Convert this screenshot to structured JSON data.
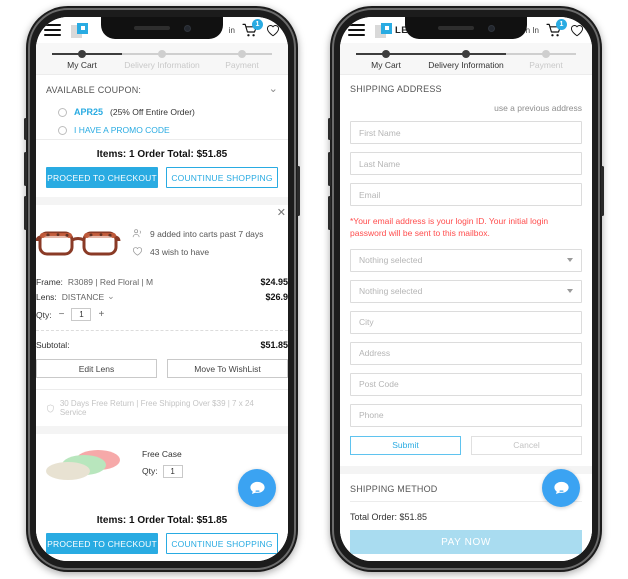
{
  "cart_phone": {
    "header": {
      "menu_icon": "hamburger-menu-icon",
      "brand_name": "",
      "sign_in_label": "in",
      "cart_icon": "shopping-cart-icon",
      "cart_badge": "1",
      "wishlist_icon": "heart-icon"
    },
    "stepper": [
      {
        "label": "My Cart",
        "state": "done"
      },
      {
        "label": "Delivery Information",
        "state": "pending"
      },
      {
        "label": "Payment",
        "state": "pending"
      }
    ],
    "coupon": {
      "title": "AVAILABLE COUPON:",
      "collapse_icon": "chevron-down-icon",
      "options": [
        {
          "code": "APR25",
          "desc": "(25% Off Entire Order)"
        }
      ],
      "promo_link": "I HAVE A PROMO CODE"
    },
    "summary_top": {
      "totals": "Items: 1   Order Total: $51.85",
      "primary_button": "PROCEED TO CHECKOUT",
      "secondary_button": "COUNTINUE SHOPPING"
    },
    "product": {
      "close_icon": "close-icon",
      "image_alt": "red-floral-eyeglasses",
      "stats": [
        {
          "icon": "people-icon",
          "text": "9 added into carts past 7 days"
        },
        {
          "icon": "heart-outline-icon",
          "text": "43 wish to have"
        }
      ],
      "attributes": [
        {
          "key": "Frame:",
          "value": "R3089 | Red Floral | M",
          "price": "$24.95"
        },
        {
          "key": "Lens:",
          "value": "DISTANCE",
          "price": "$26.9",
          "has_dropdown": true
        }
      ],
      "qty_label": "Qty:",
      "qty_minus": "−",
      "qty_value": "1",
      "qty_plus": "+",
      "subtotal_label": "Subtotal:",
      "subtotal_value": "$51.85",
      "edit_lens_button": "Edit Lens",
      "wishlist_button": "Move To WishList"
    },
    "promise": {
      "icon": "shield-icon",
      "text": "30 Days Free Return  |  Free Shipping Over $39  |  7 x 24 Service"
    },
    "free_case": {
      "image_alt": "eyeglass-cases",
      "title": "Free Case",
      "qty_label": "Qty:",
      "qty_value": "1"
    },
    "summary_bottom": {
      "totals": "Items: 1   Order Total: $51.85",
      "primary_button": "PROCEED TO CHECKOUT",
      "secondary_button": "COUNTINUE SHOPPING"
    },
    "chat_icon": "chat-bubble-icon"
  },
  "checkout_phone": {
    "header": {
      "menu_icon": "hamburger-menu-icon",
      "brand_name": "LE",
      "sign_in_label": "n In",
      "cart_icon": "shopping-cart-icon",
      "cart_badge": "1",
      "wishlist_icon": "heart-icon"
    },
    "stepper": [
      {
        "label": "My Cart",
        "state": "done"
      },
      {
        "label": "Delivery Information",
        "state": "done"
      },
      {
        "label": "Payment",
        "state": "pending"
      }
    ],
    "shipping": {
      "title": "SHIPPING ADDRESS",
      "previous_address_link": "use a previous address",
      "fields": [
        {
          "name": "first-name",
          "placeholder": "First Name",
          "type": "text"
        },
        {
          "name": "last-name",
          "placeholder": "Last Name",
          "type": "text"
        },
        {
          "name": "email",
          "placeholder": "Email",
          "type": "text"
        }
      ],
      "warning": "*Your email address is your login ID. Your initial login password will be sent to this mailbox.",
      "fields2": [
        {
          "name": "country-select",
          "placeholder": "Nothing selected",
          "type": "select"
        },
        {
          "name": "state-select",
          "placeholder": "Nothing selected",
          "type": "select"
        },
        {
          "name": "city",
          "placeholder": "City",
          "type": "text"
        },
        {
          "name": "address",
          "placeholder": "Address",
          "type": "text"
        },
        {
          "name": "post-code",
          "placeholder": "Post Code",
          "type": "text"
        },
        {
          "name": "phone",
          "placeholder": "Phone",
          "type": "text"
        }
      ],
      "submit_button": "Submit",
      "cancel_button": "Cancel"
    },
    "shipping_method": {
      "title": "SHIPPING METHOD",
      "collapse_icon": "chevron-up-icon"
    },
    "total_order": "Total Order: $51.85",
    "pay_button": "PAY NOW",
    "chat_icon": "chat-bubble-icon"
  },
  "colors": {
    "accent": "#29abe2",
    "pay_now": "#a9dcf0",
    "warning": "#ff4d4d",
    "chat": "#3ba3f2"
  }
}
